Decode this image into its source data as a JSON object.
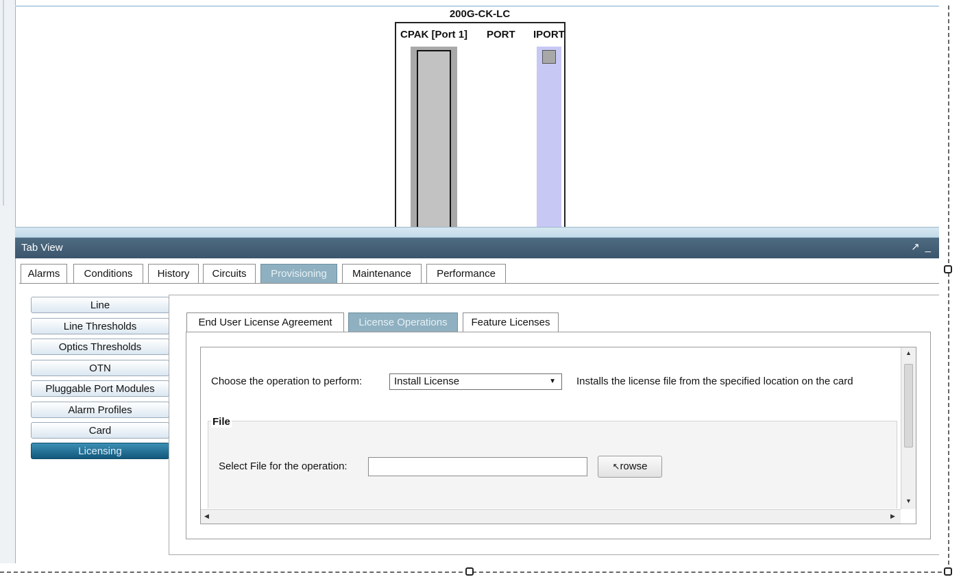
{
  "card": {
    "name": "200G-CK-LC",
    "ports": [
      "CPAK [Port 1]",
      "PORT",
      "IPORT"
    ]
  },
  "tab_view": {
    "title": "Tab View",
    "tabs": [
      "Alarms",
      "Conditions",
      "History",
      "Circuits",
      "Provisioning",
      "Maintenance",
      "Performance"
    ],
    "active_tab": "Provisioning"
  },
  "left_nav": {
    "items": [
      "Line",
      "Line Thresholds",
      "Optics Thresholds",
      "OTN",
      "Pluggable Port Modules",
      "Alarm Profiles",
      "Card",
      "Licensing"
    ],
    "active": "Licensing"
  },
  "license": {
    "subtabs": [
      "End User License Agreement",
      "License Operations",
      "Feature Licenses"
    ],
    "active_subtab": "License Operations",
    "operation_label": "Choose the operation to perform:",
    "operation_value": "Install License",
    "operation_desc": "Installs the license file from the specified location on the card",
    "file_group": "File",
    "file_label": "Select File for the operation:",
    "file_value": "",
    "browse_label": "rowse"
  },
  "colors": {
    "active_tab": "#8fb0c0",
    "active_nav": "#12587c",
    "header": "#3a556c",
    "iport": "#c8c8f5"
  }
}
